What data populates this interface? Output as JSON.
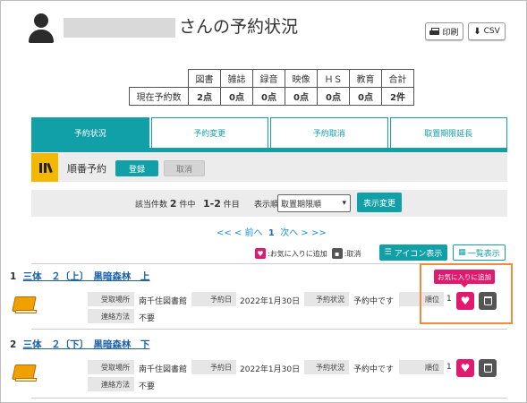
{
  "header": {
    "title": "さんの予約状況",
    "user_icon": "user-icon",
    "print_label": "印刷",
    "csv_label": "CSV"
  },
  "summary": {
    "headers": [
      "図書",
      "雑誌",
      "録音",
      "映像",
      "ＨＳ",
      "教育",
      "合計"
    ],
    "row_label": "現在予約数",
    "values": [
      "2点",
      "0点",
      "0点",
      "0点",
      "0点",
      "0点",
      "2件"
    ]
  },
  "tabs": [
    "予約状況",
    "予約変更",
    "予約取消",
    "取置期限延長"
  ],
  "order": {
    "label": "順番予約",
    "register_label": "登録",
    "cancel_label": "取消"
  },
  "filter": {
    "count_prefix": "該当件数",
    "count_total": "2",
    "count_unit": "件中",
    "range": "1-2",
    "range_unit": "件目",
    "sort_label": "表示順",
    "sort_value": "取置期限順",
    "apply_label": "表示変更"
  },
  "pager": {
    "first": "<<",
    "prev_sym": "<",
    "prev": "前へ",
    "page": "1",
    "next": "次へ",
    "next_sym": ">",
    "last": ">>"
  },
  "legend": {
    "favorite_text": ":お気に入りに追加",
    "cancel_text": ":取消"
  },
  "view": {
    "icon_label": "アイコン表示",
    "list_label": "一覧表示"
  },
  "tooltip": "お気に入りに追加",
  "labels": {
    "pickup": "受取場所",
    "reserved_date": "予約日",
    "status": "予約状況",
    "rank": "順位",
    "contact": "連絡方法"
  },
  "items": [
    {
      "no": "1",
      "title": "三体　２〔上〕　黒暗森林　上",
      "pickup": "南千住図書館",
      "date": "2022年1月30日",
      "status": "予約中です",
      "rank": "1",
      "contact": "不要"
    },
    {
      "no": "2",
      "title": "三体　２〔下〕　黒暗森林　下",
      "pickup": "南千住図書館",
      "date": "2022年1月30日",
      "status": "予約中です",
      "rank": "1",
      "contact": "不要"
    }
  ],
  "colors": {
    "accent": "#12a0a8",
    "favorite": "#e01a6e",
    "highlight": "#f08a3c",
    "order_icon_bg": "#f5b800"
  }
}
